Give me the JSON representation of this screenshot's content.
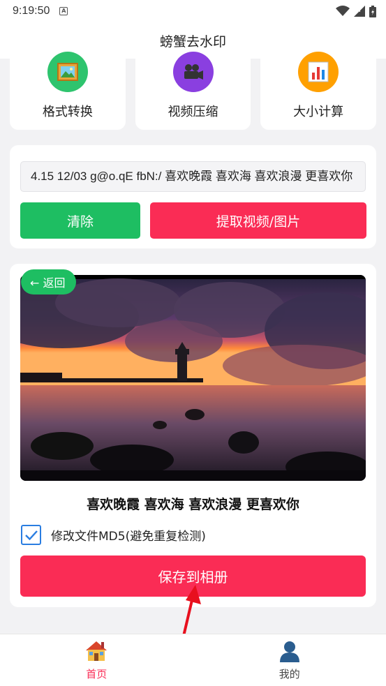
{
  "status": {
    "time": "9:19:50"
  },
  "app": {
    "title": "螃蟹去水印"
  },
  "tools": [
    {
      "label": "格式转换",
      "icon": "image-icon",
      "color": "#2ec46e"
    },
    {
      "label": "视频压缩",
      "icon": "video-camera-icon",
      "color": "#8a3fe0"
    },
    {
      "label": "大小计算",
      "icon": "bar-chart-icon",
      "color": "#ffa000"
    }
  ],
  "input": {
    "value": "4.15 12/03 g@o.qE fbN:/ 喜欢晚霞 喜欢海 喜欢浪漫 更喜欢你",
    "clear_label": "清除",
    "extract_label": "提取视频/图片"
  },
  "result": {
    "back_label": "← 返回",
    "caption": "喜欢晚霞 喜欢海 喜欢浪漫 更喜欢你",
    "md5_label": "修改文件MD5(避免重复检测)",
    "md5_checked": true,
    "save_label": "保存到相册"
  },
  "tabs": [
    {
      "label": "首页",
      "icon": "house-icon",
      "active": true
    },
    {
      "label": "我的",
      "icon": "person-icon",
      "active": false
    }
  ],
  "colors": {
    "green": "#1ebe62",
    "red": "#fa2c55",
    "checkbox_blue": "#2a7de1"
  }
}
